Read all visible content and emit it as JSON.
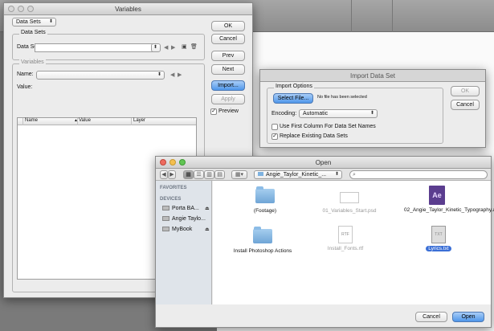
{
  "variables_window": {
    "title": "Variables",
    "define_select": "Data Sets",
    "datasets_group": "Data Sets",
    "dataset_label": "Data Set:",
    "variables_group": "Variables",
    "name_label": "Name:",
    "value_label": "Value:",
    "table_columns": [
      "Name",
      "Value",
      "Layer"
    ],
    "buttons": {
      "ok": "OK",
      "cancel": "Cancel",
      "prev": "Prev",
      "next": "Next",
      "import": "Import...",
      "apply": "Apply"
    },
    "preview_label": "Preview",
    "preview_checked": true
  },
  "import_dialog": {
    "title": "Import Data Set",
    "options_group": "Import Options",
    "select_file_button": "Select File...",
    "no_file_text": "No file has been selected",
    "encoding_label": "Encoding:",
    "encoding_value": "Automatic",
    "first_column_label": "Use First Column For Data Set Names",
    "first_column_checked": false,
    "replace_label": "Replace Existing Data Sets",
    "replace_checked": true,
    "ok_button": "OK",
    "cancel_button": "Cancel"
  },
  "open_dialog": {
    "title": "Open",
    "location": "Angie_Taylor_Kinetic_...",
    "favorites_heading": "FAVORITES",
    "devices_heading": "DEVICES",
    "devices": [
      "Porta BA...",
      "Angie Taylo...",
      "MyBook"
    ],
    "files": [
      {
        "name": "(Footage)",
        "kind": "folder",
        "selected": false
      },
      {
        "name": "01_Variables_Start.psd",
        "kind": "psd",
        "selected": false
      },
      {
        "name": "02_Angie_Taylor_Kinetic_Typography.aep",
        "kind": "aep",
        "selected": false
      },
      {
        "name": "Install Photoshop Actions",
        "kind": "folder",
        "selected": false
      },
      {
        "name": "Install_Fonts.rtf",
        "kind": "rtf",
        "selected": false
      },
      {
        "name": "Lyrics.txt",
        "kind": "txt",
        "selected": true
      }
    ],
    "icon_labels": {
      "rtf": "RTF",
      "txt": "TXT",
      "aep": "Ae"
    },
    "cancel_button": "Cancel",
    "open_button": "Open"
  }
}
